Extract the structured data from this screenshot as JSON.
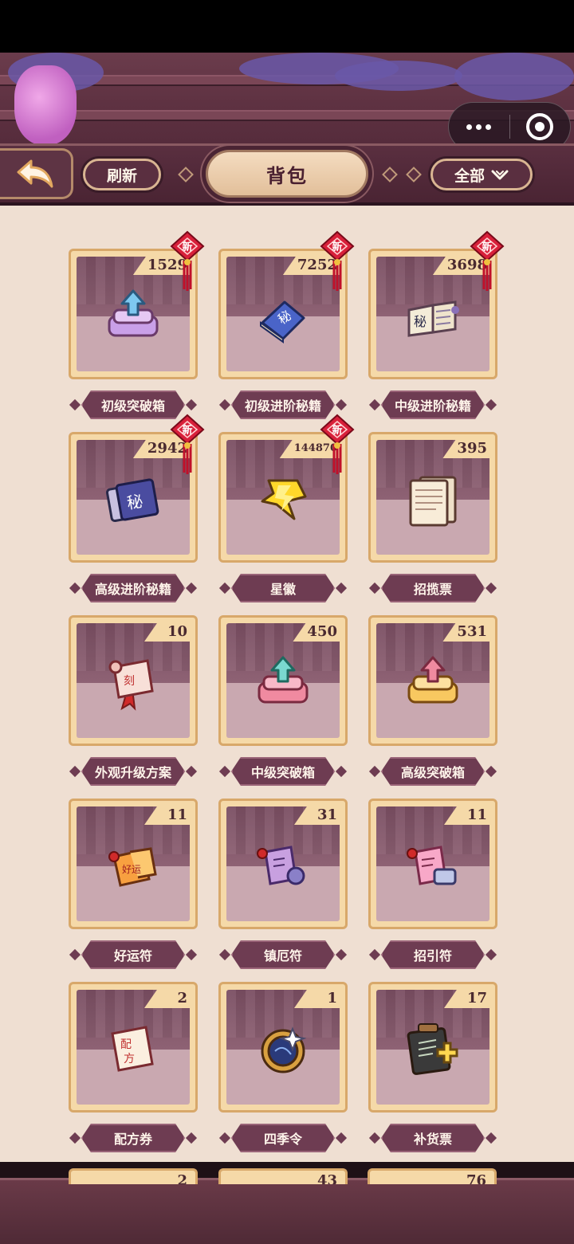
{
  "header": {
    "back_label": "",
    "refresh_label": "刷新",
    "title": "背包",
    "filter_label": "全部"
  },
  "mini_program_capsule": {
    "more_icon": "more-dots-icon",
    "close_icon": "target-close-icon"
  },
  "new_badge_text": "新",
  "items": [
    {
      "name": "初级突破箱",
      "count": "1529",
      "is_new": true,
      "icon": "primary-breakthrough-box-icon"
    },
    {
      "name": "初级进阶秘籍",
      "count": "7252",
      "is_new": true,
      "icon": "primary-advanced-manual-icon"
    },
    {
      "name": "中级进阶秘籍",
      "count": "3698",
      "is_new": true,
      "icon": "intermediate-advanced-manual-icon"
    },
    {
      "name": "高级进阶秘籍",
      "count": "2942",
      "is_new": true,
      "icon": "advanced-manual-icon"
    },
    {
      "name": "星徽",
      "count": "144870",
      "is_new": true,
      "icon": "star-emblem-icon"
    },
    {
      "name": "招揽票",
      "count": "395",
      "is_new": false,
      "icon": "recruit-ticket-icon"
    },
    {
      "name": "外观升级方案",
      "count": "10",
      "is_new": false,
      "icon": "appearance-upgrade-scroll-icon"
    },
    {
      "name": "中级突破箱",
      "count": "450",
      "is_new": false,
      "icon": "intermediate-breakthrough-box-icon"
    },
    {
      "name": "高级突破箱",
      "count": "531",
      "is_new": false,
      "icon": "advanced-breakthrough-box-icon"
    },
    {
      "name": "好运符",
      "count": "11",
      "is_new": false,
      "icon": "good-luck-talisman-icon"
    },
    {
      "name": "镇厄符",
      "count": "31",
      "is_new": false,
      "icon": "ward-talisman-icon"
    },
    {
      "name": "招引符",
      "count": "11",
      "is_new": false,
      "icon": "attract-talisman-icon"
    },
    {
      "name": "配方券",
      "count": "2",
      "is_new": false,
      "icon": "recipe-coupon-icon"
    },
    {
      "name": "四季令",
      "count": "1",
      "is_new": false,
      "icon": "four-seasons-token-icon"
    },
    {
      "name": "补货票",
      "count": "17",
      "is_new": false,
      "icon": "restock-ticket-icon"
    }
  ],
  "peek_row_counts": [
    "2",
    "43",
    "76"
  ],
  "colors": {
    "background": "#efdfd2",
    "card_frame": "#f5d9a8",
    "plate": "#6e3c52",
    "new_badge": "#d8203a"
  }
}
